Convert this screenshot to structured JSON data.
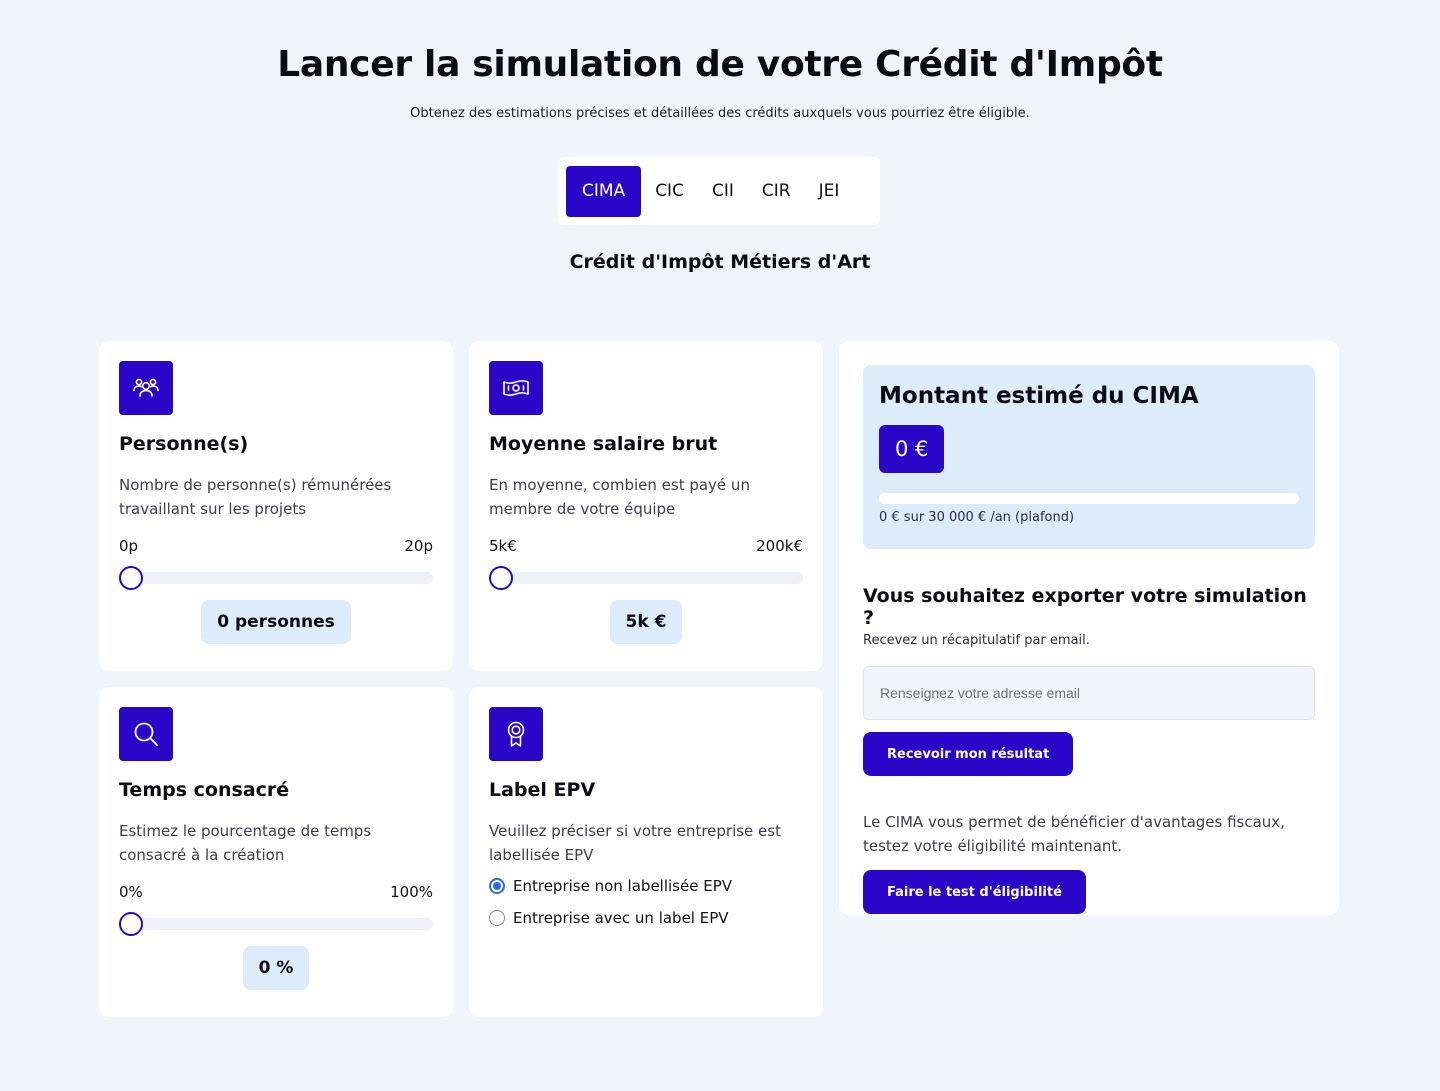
{
  "header": {
    "title": "Lancer la simulation de votre Crédit d'Impôt",
    "subtitle": "Obtenez des estimations précises et détaillées des crédits auxquels vous pourriez être éligible."
  },
  "tabs": [
    {
      "label": "CIMA",
      "active": true
    },
    {
      "label": "CIC",
      "active": false
    },
    {
      "label": "CII",
      "active": false
    },
    {
      "label": "CIR",
      "active": false
    },
    {
      "label": "JEI",
      "active": false
    }
  ],
  "credit_name": "Crédit d'Impôt Métiers d'Art",
  "cards": {
    "persons": {
      "icon": "people-icon",
      "title": "Personne(s)",
      "description": "Nombre de personne(s) rémunérées travaillant sur les projets",
      "min_label": "0p",
      "max_label": "20p",
      "value": 0,
      "value_label": "0 personnes"
    },
    "salary": {
      "icon": "banknote-icon",
      "title": "Moyenne salaire brut",
      "description": "En moyenne, combien est payé un membre de votre équipe",
      "min_label": "5k€",
      "max_label": "200k€",
      "value": 0,
      "value_label": "5k €"
    },
    "time": {
      "icon": "search-icon",
      "title": "Temps consacré",
      "description": "Estimez le pourcentage de temps consacré à la création",
      "min_label": "0%",
      "max_label": "100%",
      "value": 0,
      "value_label": "0 %"
    },
    "label_epv": {
      "icon": "award-icon",
      "title": "Label EPV",
      "description": "Veuillez préciser si votre entreprise est labellisée EPV",
      "options": [
        {
          "label": "Entreprise non labellisée EPV",
          "checked": true
        },
        {
          "label": "Entreprise avec un label EPV",
          "checked": false
        }
      ]
    }
  },
  "result": {
    "title": "Montant estimé du CIMA",
    "amount": "0 €",
    "progress": 0,
    "cap_text": "0 € sur 30 000 € /an (plafond)",
    "export_title": "Vous souhaitez exporter votre simulation ?",
    "export_subtitle": "Recevez un récapitulatif par email.",
    "email_placeholder": "Renseignez votre adresse email",
    "email_value": "",
    "receive_button": "Recevoir mon résultat",
    "info_text": "Le CIMA vous permet de bénéficier d'avantages fiscaux, testez votre éligibilité maintenant.",
    "test_button": "Faire le test d'éligibilité"
  },
  "colors": {
    "background": "#f1f5fb",
    "primary": "#2a06c9",
    "pill": "#dcecfb",
    "radio": "#2f6be0"
  }
}
